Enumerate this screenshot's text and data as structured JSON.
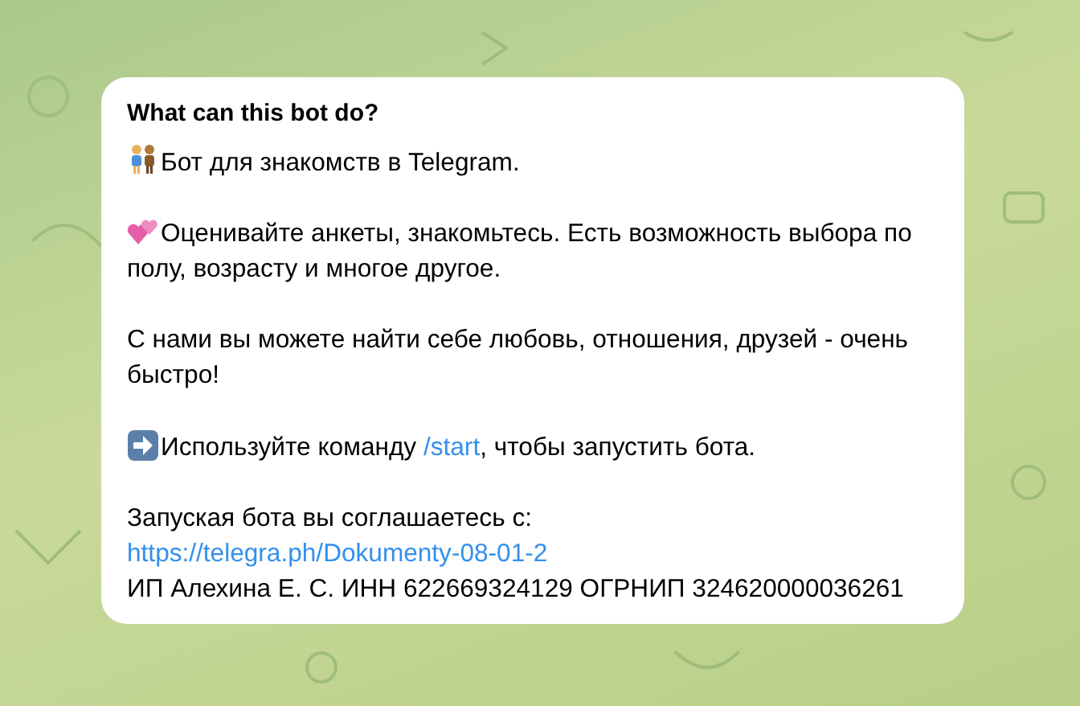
{
  "bot_info": {
    "title": "What can this bot do?",
    "paragraphs": [
      {
        "lines": [
          [
            {
              "kind": "text",
              "text": "Бот для знакомств в Telegram."
            }
          ]
        ]
      },
      {
        "lines": [
          [
            {
              "kind": "text",
              "text": "Оценивайте анкеты, знакомьтесь. Есть возможность выбора по полу, возрасту и многое другое."
            }
          ]
        ]
      },
      {
        "lines": [
          [
            {
              "kind": "text",
              "text": "С нами вы можете найти себе любовь, отношения, друзей - очень быстро!"
            }
          ]
        ]
      },
      {
        "lines": [
          [
            {
              "kind": "text",
              "text": "Используйте команду "
            },
            {
              "kind": "link",
              "text": "/start"
            },
            {
              "kind": "text",
              "text": ", чтобы запустить бота."
            }
          ]
        ]
      },
      {
        "lines": [
          [
            {
              "kind": "text",
              "text": "Запуская бота вы соглашаетесь с:"
            }
          ],
          [
            {
              "kind": "link",
              "text": "https://telegra.ph/Dokumenty-08-01-2"
            }
          ],
          [
            {
              "kind": "text",
              "text": "ИП Алехина Е. С. ИНН 622669324129 ОГРНИП 324620000036261"
            }
          ]
        ]
      }
    ]
  }
}
